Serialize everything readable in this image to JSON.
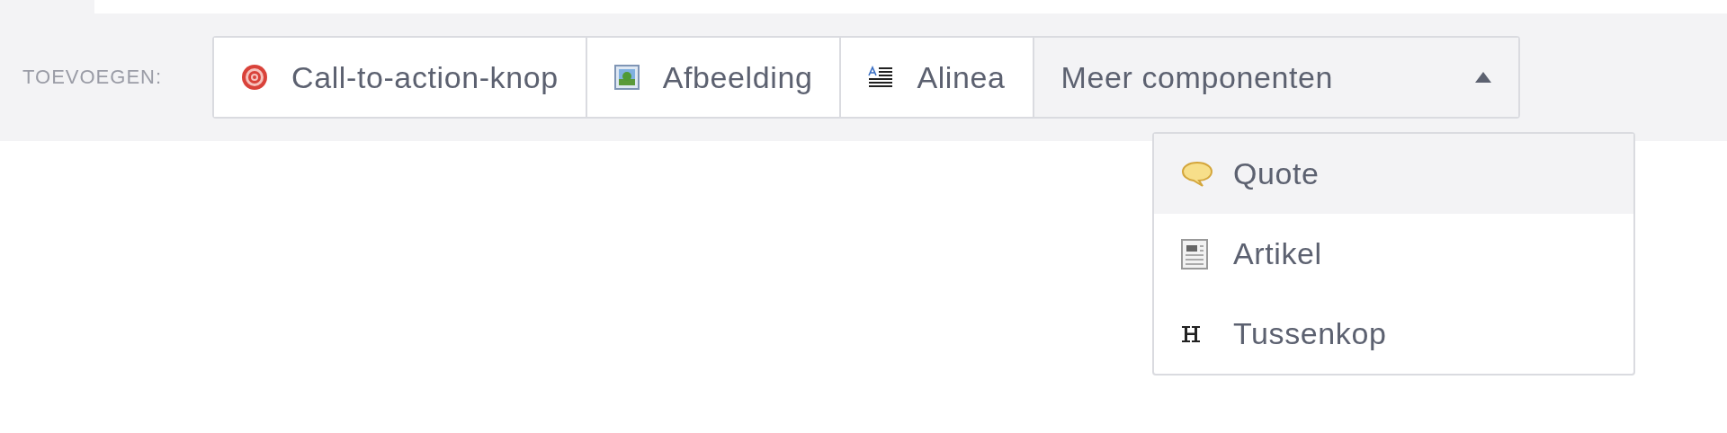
{
  "toolbar": {
    "label": "TOEVOEGEN:",
    "buttons": [
      {
        "kind": "target",
        "label": "Call-to-action-knop"
      },
      {
        "kind": "image",
        "label": "Afbeelding"
      },
      {
        "kind": "paragraph",
        "label": "Alinea"
      }
    ],
    "more": {
      "label": "Meer componenten",
      "expanded": true
    },
    "menu": [
      {
        "kind": "quote",
        "label": "Quote",
        "selected": true
      },
      {
        "kind": "article",
        "label": "Artikel",
        "selected": false
      },
      {
        "kind": "heading",
        "label": "Tussenkop",
        "selected": false
      }
    ]
  }
}
